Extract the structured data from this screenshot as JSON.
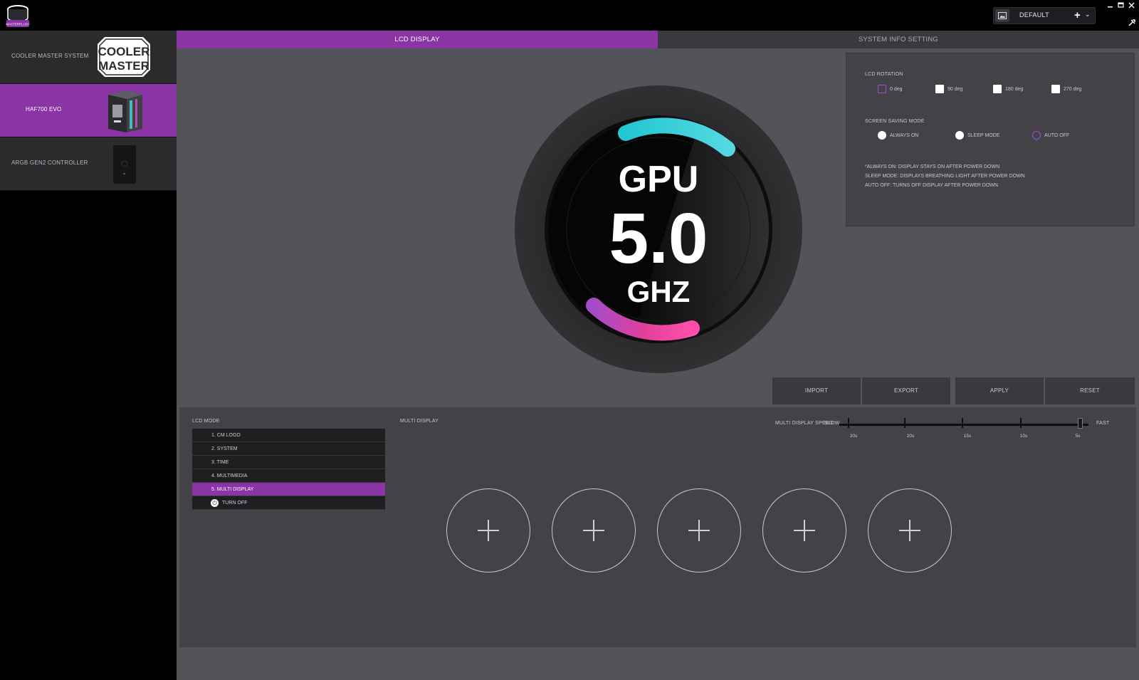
{
  "app": {
    "logo_text": "MASTERPLUS+",
    "profile_name": "DEFAULT",
    "profile_add": "+",
    "profile_dropdown": "⌄"
  },
  "sidebar": {
    "devices": [
      {
        "label": "COOLER MASTER SYSTEM",
        "brand_logo_line1": "COOLER",
        "brand_logo_line2": "MASTER"
      },
      {
        "label": "HAF700 EVO"
      },
      {
        "label": "ARGB GEN2 CONTROLLER"
      }
    ]
  },
  "tabs": [
    {
      "label": "LCD DISPLAY"
    },
    {
      "label": "SYSTEM INFO SETTING"
    }
  ],
  "preview": {
    "title": "GPU",
    "value": "5.0",
    "unit": "GHZ"
  },
  "lcd_rotation": {
    "heading": "LCD ROTATION",
    "options": [
      "0 deg",
      "90 deg",
      "180 deg",
      "270 deg"
    ],
    "selected": "0 deg"
  },
  "screen_saving": {
    "heading": "SCREEN SAVING MODE",
    "options": [
      "ALWAYS ON",
      "SLEEP MODE",
      "AUTO OFF"
    ],
    "selected": "AUTO OFF",
    "notes": [
      "*ALWAYS ON: DISPLAY STAYS ON AFTER POWER DOWN",
      "SLEEP MODE: DISPLAYS BREATHING LIGHT AFTER POWER DOWN",
      "AUTO OFF: TURNS OFF DISPLAY AFTER POWER DOWN"
    ]
  },
  "actions": {
    "import": "IMPORT",
    "export": "EXPORT",
    "apply": "APPLY",
    "reset": "RESET"
  },
  "lcd_mode": {
    "heading": "LCD MODE",
    "items": [
      "1. CM LOGO",
      "2. SYSTEM",
      "3. TIME",
      "4. MULTIMEDIA",
      "5. MULTI DISPLAY"
    ],
    "selected": "5. MULTI DISPLAY",
    "turn_off": "TURN OFF"
  },
  "multi_display": {
    "heading": "MULTI DISPLAY",
    "slot_count": 5,
    "speed_label": "MULTI DISPLAY SPEED",
    "slow_label": "SLOW",
    "fast_label": "FAST",
    "speed_ticks": [
      "30s",
      "20s",
      "15s",
      "10s",
      "5s"
    ],
    "speed_value": "5s"
  },
  "colors": {
    "accent": "#8a34a6",
    "accent_outline": "#a64bd0",
    "cyan_arc": "#33cfd8",
    "pink_arc": "#e0409a"
  }
}
